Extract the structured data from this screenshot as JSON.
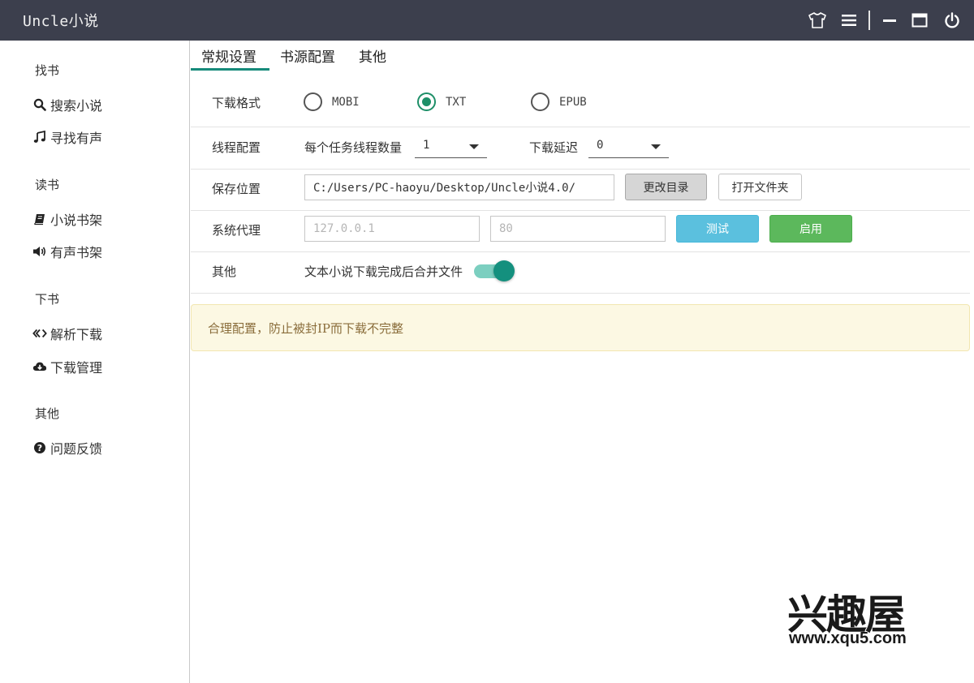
{
  "app": {
    "title": "Uncle小说"
  },
  "titlebar": {
    "icons": [
      "shirt-icon",
      "menu-icon",
      "minimize-icon",
      "maximize-icon",
      "power-icon"
    ]
  },
  "sidebar": {
    "sections": [
      {
        "title": "找书",
        "items": [
          {
            "label": "搜索小说",
            "icon": "search-icon"
          },
          {
            "label": "寻找有声",
            "icon": "music-icon"
          }
        ]
      },
      {
        "title": "读书",
        "items": [
          {
            "label": "小说书架",
            "icon": "book-icon"
          },
          {
            "label": "有声书架",
            "icon": "volume-icon"
          }
        ]
      },
      {
        "title": "下书",
        "items": [
          {
            "label": "解析下载",
            "icon": "code-icon"
          },
          {
            "label": "下载管理",
            "icon": "cloud-download-icon"
          }
        ]
      },
      {
        "title": "其他",
        "items": [
          {
            "label": "问题反馈",
            "icon": "question-icon"
          }
        ]
      }
    ]
  },
  "tabs": [
    {
      "label": "常规设置",
      "active": true
    },
    {
      "label": "书源配置",
      "active": false
    },
    {
      "label": "其他",
      "active": false
    }
  ],
  "settings": {
    "format": {
      "label": "下载格式",
      "options": [
        "MOBI",
        "TXT",
        "EPUB"
      ],
      "selected": "TXT"
    },
    "threads": {
      "label": "线程配置",
      "count_label": "每个任务线程数量",
      "count_value": "1",
      "delay_label": "下载延迟",
      "delay_value": "0"
    },
    "save": {
      "label": "保存位置",
      "path": "C:/Users/PC-haoyu/Desktop/Uncle小说4.0/",
      "change_button": "更改目录",
      "open_button": "打开文件夹"
    },
    "proxy": {
      "label": "系统代理",
      "host_placeholder": "127.0.0.1",
      "port_placeholder": "80",
      "test_button": "测试",
      "enable_button": "启用"
    },
    "other": {
      "label": "其他",
      "merge_label": "文本小说下载完成后合并文件",
      "merge_enabled": true
    }
  },
  "alert": {
    "text": "合理配置，防止被封IP而下载不完整"
  },
  "watermark": {
    "brand": "兴趣屋",
    "url": "www.xqu5.com"
  },
  "colors": {
    "titlebar": "#3c3f4d",
    "accent": "#168a7a",
    "radio": "#1e8f68",
    "info": "#5bc0de",
    "success": "#5cb85c",
    "alert_bg": "#fcf8e3"
  }
}
